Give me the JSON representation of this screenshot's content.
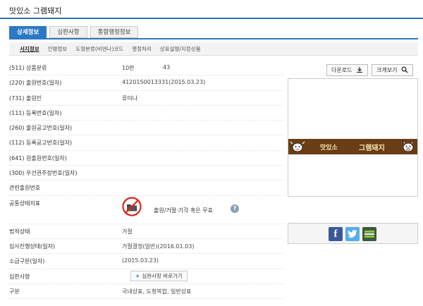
{
  "header": {
    "title": "맛있소 그램돼지"
  },
  "tabs": [
    {
      "label": "상세정보",
      "active": true
    },
    {
      "label": "심판사항",
      "active": false
    },
    {
      "label": "통합행정정보",
      "active": false
    }
  ],
  "subtabs": [
    {
      "label": "서지정보",
      "active": true
    },
    {
      "label": "인명정보",
      "active": false
    },
    {
      "label": "도형분류(비엔나)코드",
      "active": false
    },
    {
      "label": "행정처리",
      "active": false
    },
    {
      "label": "상표설명/지정상품",
      "active": false
    }
  ],
  "actions": {
    "download_label": "다운로드",
    "zoom_label": "크게보기"
  },
  "fields": {
    "class": {
      "label": "(511) 상품분류",
      "value": "10판",
      "value2": "43"
    },
    "app_no": {
      "label": "(220) 출원번호(일자)",
      "value": "4120150013331(2015.03.23)"
    },
    "applicant": {
      "label": "(731) 출원인",
      "value": "류미나"
    },
    "reg_no": {
      "label": "(111) 등록번호(일자)",
      "value": ""
    },
    "pub_no": {
      "label": "(260) 출원공고번호(일자)",
      "value": ""
    },
    "reg_pub_no": {
      "label": "(112) 등록공고번호(일자)",
      "value": ""
    },
    "orig_app_no": {
      "label": "(641) 원출원번호(일자)",
      "value": ""
    },
    "priority_no": {
      "label": "(300) 우선권주장번호(일자)",
      "value": ""
    },
    "related_app": {
      "label": "관련출원번호",
      "value": ""
    },
    "public_status": {
      "label": "공통상태지표",
      "value": "출원/거절·기각 혹은 무효"
    },
    "legal_status": {
      "label": "법적상태",
      "value": "거절"
    },
    "exam_status": {
      "label": "심사진행상태(일자)",
      "value": "거절결정(일반)(2016.01.03)"
    },
    "retro_date": {
      "label": "소급구분(일자)",
      "value": "(2015.03.23)"
    },
    "trial": {
      "label": "심판사항",
      "button_label": "심판사항 바로가기"
    },
    "kind": {
      "label": "구분",
      "value": "국내상표, 도형복합, 일반상표"
    }
  },
  "logo": {
    "left_text": "맛있소",
    "right_text": "그램돼지"
  },
  "share": {
    "items": [
      "facebook-icon",
      "twitter-icon",
      "band-icon"
    ]
  },
  "colors": {
    "accent": "#2b78c5",
    "logo_band": "#6b3d14",
    "facebook": "#3b5998",
    "twitter": "#55acee",
    "band": "#3d5a3f"
  }
}
